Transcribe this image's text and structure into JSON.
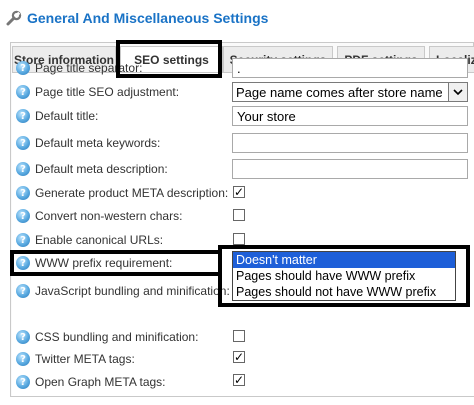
{
  "page": {
    "title": "General And Miscellaneous Settings"
  },
  "tabs": [
    {
      "label": "Store information"
    },
    {
      "label": "SEO settings"
    },
    {
      "label": "Security settings"
    },
    {
      "label": "PDF settings"
    },
    {
      "label": "Localizati"
    }
  ],
  "form": {
    "page_title_separator": {
      "label": "Page title separator:",
      "value": "."
    },
    "page_title_seo_adjustment": {
      "label": "Page title SEO adjustment:",
      "value": "Page name comes after store name"
    },
    "default_title": {
      "label": "Default title:",
      "value": "Your store"
    },
    "default_meta_keywords": {
      "label": "Default meta keywords:",
      "value": ""
    },
    "default_meta_description": {
      "label": "Default meta description:",
      "value": ""
    },
    "generate_product_meta": {
      "label": "Generate product META description:",
      "checked": true
    },
    "convert_non_western": {
      "label": "Convert non-western chars:",
      "checked": false
    },
    "enable_canonical": {
      "label": "Enable canonical URLs:",
      "checked": false
    },
    "www_prefix": {
      "label": "WWW prefix requirement:",
      "options": [
        "Doesn't matter",
        "Pages should have WWW prefix",
        "Pages should not have WWW prefix"
      ],
      "selected": "Doesn't matter"
    },
    "js_bundling": {
      "label": "JavaScript bundling and minification:",
      "checked": false
    },
    "css_bundling": {
      "label": "CSS bundling and minification:",
      "checked": false
    },
    "twitter_meta": {
      "label": "Twitter META tags:",
      "checked": true
    },
    "open_graph_meta": {
      "label": "Open Graph META tags:",
      "checked": true
    }
  },
  "icons": {
    "title_icon": "wrench-icon",
    "help_icon": "help-question-icon"
  },
  "colors": {
    "title": "#1a73c6",
    "selected_option": "#1e5fd8"
  }
}
